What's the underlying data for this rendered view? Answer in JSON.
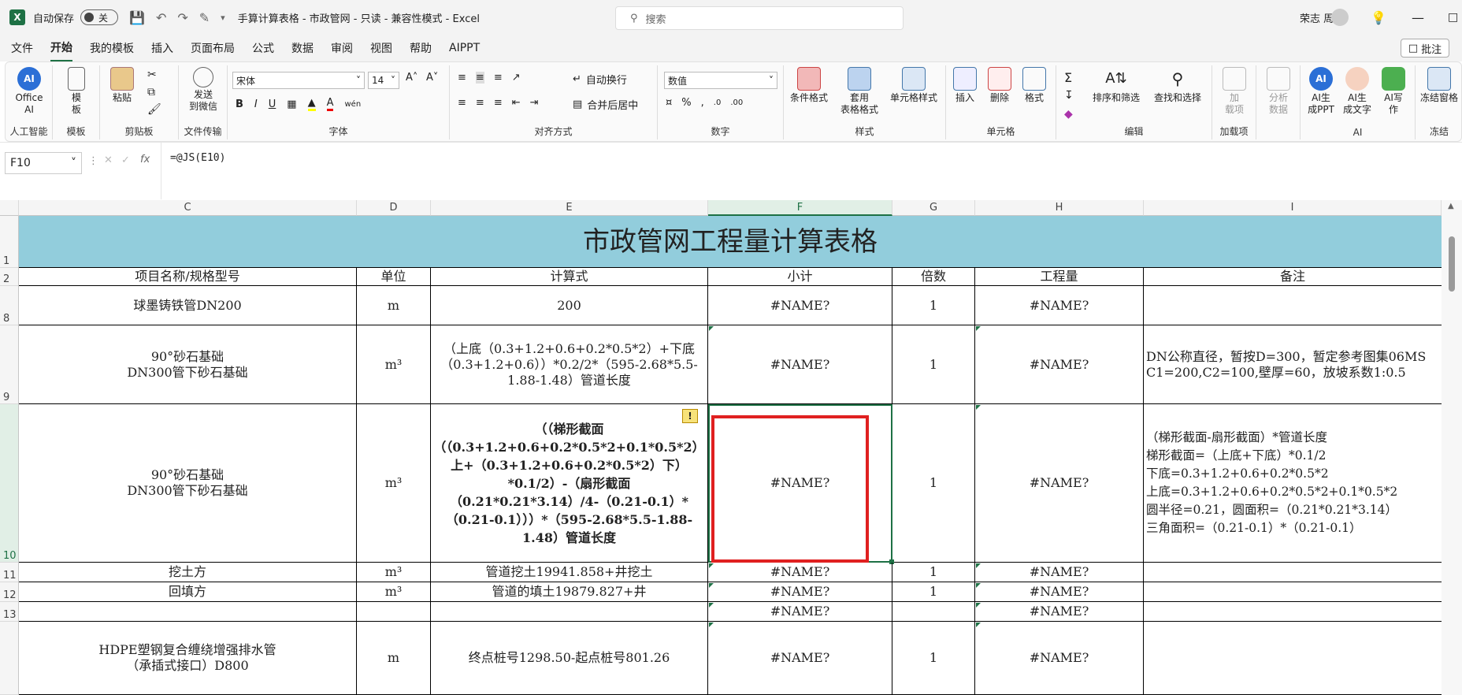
{
  "titlebar": {
    "autosave_label": "自动保存",
    "autosave_state": "关",
    "document_title": "手算计算表格 - 市政管网 - 只读 - 兼容性模式 - Excel",
    "search_placeholder": "搜索",
    "user_name": "荣志 周"
  },
  "menu": {
    "items": [
      "文件",
      "开始",
      "我的模板",
      "插入",
      "页面布局",
      "公式",
      "数据",
      "审阅",
      "视图",
      "帮助",
      "AIPPT"
    ],
    "active": "开始",
    "comments_label": "批注"
  },
  "ribbon": {
    "ai_group": {
      "button": "Office\nAI",
      "label": "人工智能"
    },
    "template_group": {
      "button": "模\n板",
      "label": "模板"
    },
    "clipboard_group": {
      "paste": "粘贴",
      "label": "剪贴板"
    },
    "transfer_group": {
      "button": "发送\n到微信",
      "label": "文件传输"
    },
    "font_group": {
      "font_name": "宋体",
      "font_size": "14",
      "label": "字体"
    },
    "align_group": {
      "wrap": "自动换行",
      "merge": "合并后居中",
      "label": "对齐方式"
    },
    "number_group": {
      "format": "数值",
      "label": "数字"
    },
    "style_group": {
      "cond": "条件格式",
      "table": "套用\n表格格式",
      "cell": "单元格样式",
      "label": "样式"
    },
    "cells_group": {
      "insert": "插入",
      "delete": "删除",
      "format": "格式",
      "label": "单元格"
    },
    "edit_group": {
      "sort": "排序和筛选",
      "find": "查找和选择",
      "label": "编辑"
    },
    "addin_group": {
      "button": "加\n载项",
      "label": "加载项"
    },
    "analyze": {
      "button": "分析\n数据"
    },
    "ai_tools": {
      "ppt": "AI生\n成PPT",
      "text": "AI生\n成文字",
      "write": "AI写\n作",
      "label": "AI"
    },
    "freeze": {
      "button": "冻结窗格",
      "label": "冻结"
    }
  },
  "formula_bar": {
    "name_box": "F10",
    "formula": "=@JS(E10)"
  },
  "sheet": {
    "columns": [
      "C",
      "D",
      "E",
      "F",
      "G",
      "H",
      "I"
    ],
    "title": "市政管网工程量计算表格",
    "headers": [
      "项目名称/规格型号",
      "单位",
      "计算式",
      "小计",
      "倍数",
      "工程量",
      "备注"
    ],
    "rows": [
      {
        "num": "8",
        "name": "球墨铸铁管DN200",
        "unit": "m",
        "expr": "200",
        "subtotal": "#NAME?",
        "mult": "1",
        "qty": "#NAME?",
        "note": ""
      },
      {
        "num": "9",
        "name": "90°砂石基础\nDN300管下砂石基础",
        "unit": "m³",
        "expr": "（上底（0.3+1.2+0.6+0.2*0.5*2）+下底（0.3+1.2+0.6））*0.2/2*（595-2.68*5.5-1.88-1.48）管道长度",
        "subtotal": "#NAME?",
        "mult": "1",
        "qty": "#NAME?",
        "note": "DN公称直径，暂按D=300，暂定参考图集06MS\nC1=200,C2=100,壁厚=60，放坡系数1:0.5"
      },
      {
        "num": "10",
        "name": "90°砂石基础\nDN300管下砂石基础",
        "unit": "m³",
        "expr": "（（梯形截面（（0.3+1.2+0.6+0.2*0.5*2+0.1*0.5*2）上+（0.3+1.2+0.6+0.2*0.5*2）下）*0.1/2）-（扇形截面（0.21*0.21*3.14）/4-（0.21-0.1）*（0.21-0.1）））*（595-2.68*5.5-1.88-1.48）管道长度",
        "subtotal": "#NAME?",
        "mult": "1",
        "qty": "#NAME?",
        "note": "（梯形截面-扇形截面）*管道长度\n梯形截面=（上底+下底）*0.1/2\n下底=0.3+1.2+0.6+0.2*0.5*2\n上底=0.3+1.2+0.6+0.2*0.5*2+0.1*0.5*2\n圆半径=0.21，圆面积=（0.21*0.21*3.14）\n三角面积=（0.21-0.1）*（0.21-0.1）"
      },
      {
        "num": "11",
        "name": "挖土方",
        "unit": "m³",
        "expr": "管道挖土19941.858+井挖土",
        "subtotal": "#NAME?",
        "mult": "1",
        "qty": "#NAME?",
        "note": ""
      },
      {
        "num": "12",
        "name": "回填方",
        "unit": "m³",
        "expr": "管道的填土19879.827+井",
        "subtotal": "#NAME?",
        "mult": "1",
        "qty": "#NAME?",
        "note": ""
      },
      {
        "num": "13",
        "name": "",
        "unit": "",
        "expr": "",
        "subtotal": "#NAME?",
        "mult": "",
        "qty": "#NAME?",
        "note": ""
      },
      {
        "num": "",
        "name": "HDPE塑钢复合缠绕增强排水管\n（承插式接口）D800",
        "unit": "m",
        "expr": "终点桩号1298.50-起点桩号801.26",
        "subtotal": "#NAME?",
        "mult": "1",
        "qty": "#NAME?",
        "note": ""
      }
    ]
  },
  "colors": {
    "accent": "#1e7145",
    "title_fill": "#92cddc",
    "highlight": "#e02020"
  }
}
